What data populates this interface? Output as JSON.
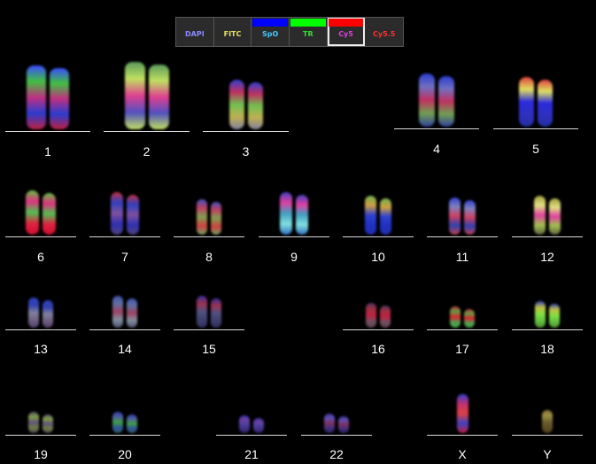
{
  "toolbar": {
    "buttons": [
      {
        "label": "DAPI",
        "swatch": "",
        "text_color": "#8a8aff",
        "selected": false
      },
      {
        "label": "FITC",
        "swatch": "",
        "text_color": "#e8e060",
        "selected": false
      },
      {
        "label": "SpO",
        "swatch": "#0000ff",
        "text_color": "#40c8ff",
        "selected": false
      },
      {
        "label": "TR",
        "swatch": "#00ff00",
        "text_color": "#30e030",
        "selected": false
      },
      {
        "label": "Cy5",
        "swatch": "#ff0000",
        "text_color": "#e040e0",
        "selected": true
      },
      {
        "label": "Cy5.5",
        "swatch": "",
        "text_color": "#ff3030",
        "selected": false
      }
    ]
  },
  "karyotype": [
    {
      "label": "1",
      "colors": [
        "#3a4cff",
        "#40c040",
        "#c03080",
        "#2a3cd0",
        "#c02040"
      ]
    },
    {
      "label": "2",
      "colors": [
        "#5a9a5a",
        "#c0e060",
        "#e04090",
        "#5050c0",
        "#c0e060"
      ]
    },
    {
      "label": "3",
      "colors": [
        "#3040d0",
        "#c03060",
        "#70c050",
        "#c0b050",
        "#8080a0"
      ]
    },
    {
      "label": "4",
      "colors": [
        "#2a3cd0",
        "#7070c0",
        "#c03060",
        "#70a050",
        "#3040a0"
      ]
    },
    {
      "label": "5",
      "colors": [
        "#e04040",
        "#e0e060",
        "#2a2ae0",
        "#3030c0",
        "#2030a0"
      ]
    },
    {
      "label": "6",
      "colors": [
        "#60c040",
        "#e03080",
        "#50c050",
        "#e02040",
        "#d01030"
      ]
    },
    {
      "label": "7",
      "colors": [
        "#c03040",
        "#3040c0",
        "#8050a0",
        "#3030b0",
        "#504080"
      ]
    },
    {
      "label": "8",
      "colors": [
        "#4050c0",
        "#c04060",
        "#80a050",
        "#d04040",
        "#70a060"
      ]
    },
    {
      "label": "9",
      "colors": [
        "#4040c0",
        "#e040a0",
        "#40a0c0",
        "#80e0e0",
        "#3070c0"
      ]
    },
    {
      "label": "10",
      "colors": [
        "#70b050",
        "#d0a040",
        "#3040d0",
        "#2030c0",
        "#2030b0"
      ]
    },
    {
      "label": "11",
      "colors": [
        "#3040d0",
        "#8080c0",
        "#d04060",
        "#3040b0",
        "#c04050"
      ]
    },
    {
      "label": "12",
      "colors": [
        "#a0a040",
        "#e0e080",
        "#e040a0",
        "#a0c050",
        "#606040"
      ]
    },
    {
      "label": "13",
      "colors": [
        "#3040c0",
        "#3040b0",
        "#8080a0",
        "#706080",
        "#504070"
      ]
    },
    {
      "label": "14",
      "colors": [
        "#4050b0",
        "#6070a0",
        "#a04060",
        "#8090a0",
        "#505070"
      ]
    },
    {
      "label": "15",
      "colors": [
        "#3030a0",
        "#a03050",
        "#505080",
        "#404070",
        "#303060"
      ]
    },
    {
      "label": "16",
      "colors": [
        "#503060",
        "#a03040",
        "#c02040",
        "#705060",
        "#604050"
      ]
    },
    {
      "label": "17",
      "colors": [
        "#c03040",
        "#60a040",
        "#e02030",
        "#50a050",
        "#40a040"
      ]
    },
    {
      "label": "18",
      "colors": [
        "#3040c0",
        "#c0c040",
        "#80e040",
        "#60c040",
        "#509030"
      ]
    },
    {
      "label": "19",
      "colors": [
        "#505070",
        "#80a040",
        "#605080",
        "#708040",
        "#504060"
      ]
    },
    {
      "label": "20",
      "colors": [
        "#3040b0",
        "#5060a0",
        "#40a040",
        "#3050a0",
        "#306060"
      ]
    },
    {
      "label": "21",
      "colors": [
        "#3030b0",
        "#7040a0",
        "#5040a0",
        "#403080",
        "#302070"
      ]
    },
    {
      "label": "22",
      "colors": [
        "#4030a0",
        "#6050b0",
        "#803060",
        "#403080",
        "#302060"
      ]
    },
    {
      "label": "X",
      "colors": [
        "#3040d0",
        "#c03070",
        "#e04040",
        "#4040c0",
        "#c02040"
      ]
    },
    {
      "label": "Y",
      "colors": [
        "#807030",
        "#a09040",
        "#706030",
        "#605020",
        "#504020"
      ]
    }
  ]
}
